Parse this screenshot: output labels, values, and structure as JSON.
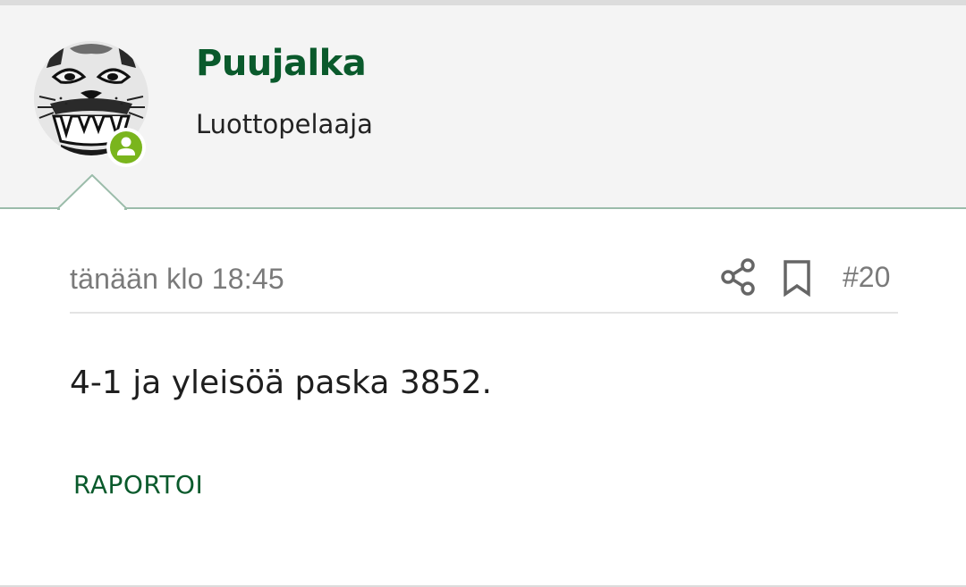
{
  "post": {
    "author": {
      "name": "Puujalka",
      "title": "Luottopelaaja",
      "avatar_icon": "lynx-face-avatar",
      "status_icon": "online-user-badge-icon",
      "status_color": "#7ab51d"
    },
    "timestamp": "tänään klo 18:45",
    "actions": {
      "share_icon": "share-icon",
      "bookmark_icon": "bookmark-icon",
      "post_number": "#20"
    },
    "body": "4-1 ja yleisöä paska 3852.",
    "report_label": "RAPORTOI"
  },
  "colors": {
    "brand_green": "#0a5a2c",
    "header_bg": "#f4f4f4",
    "header_border": "#9bbcaa",
    "muted_text": "#7a7a7a"
  }
}
